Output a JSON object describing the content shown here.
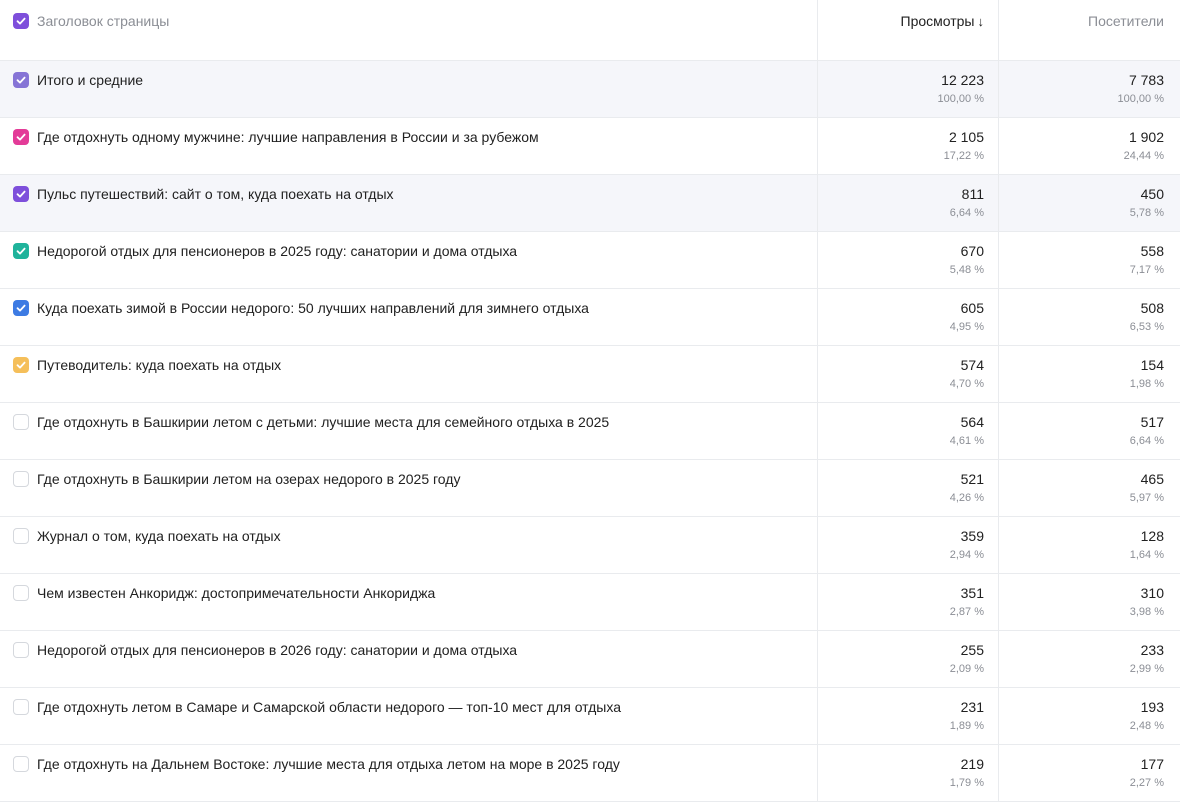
{
  "header": {
    "title_label": "Заголовок страницы",
    "views_label": "Просмотры",
    "sort_arrow": "↓",
    "visitors_label": "Посетители",
    "checkbox_color": "#7e4fdb"
  },
  "rows": [
    {
      "title": "Итого и средние",
      "views": "12 223",
      "views_pct": "100,00 %",
      "visitors": "7 783",
      "visitors_pct": "100,00 %",
      "color": "#8674d6",
      "checked": true,
      "shade": true
    },
    {
      "title": "Где отдохнуть одному мужчине: лучшие направления в России и за рубежом",
      "views": "2 105",
      "views_pct": "17,22 %",
      "visitors": "1 902",
      "visitors_pct": "24,44 %",
      "color": "#e33b98",
      "checked": true,
      "shade": false
    },
    {
      "title": "Пульс путешествий: сайт о том, куда поехать на отдых",
      "views": "811",
      "views_pct": "6,64 %",
      "visitors": "450",
      "visitors_pct": "5,78 %",
      "color": "#7e4fdb",
      "checked": true,
      "shade": true
    },
    {
      "title": "Недорогой отдых для пенсионеров в 2025 году: санатории и дома отдыха",
      "views": "670",
      "views_pct": "5,48 %",
      "visitors": "558",
      "visitors_pct": "7,17 %",
      "color": "#1fb39b",
      "checked": true,
      "shade": false
    },
    {
      "title": "Куда поехать зимой в России недорого: 50 лучших направлений для зимнего отдыха",
      "views": "605",
      "views_pct": "4,95 %",
      "visitors": "508",
      "visitors_pct": "6,53 %",
      "color": "#3d7be3",
      "checked": true,
      "shade": false
    },
    {
      "title": "Путеводитель: куда поехать на отдых",
      "views": "574",
      "views_pct": "4,70 %",
      "visitors": "154",
      "visitors_pct": "1,98 %",
      "color": "#f5bf5a",
      "checked": true,
      "shade": false
    },
    {
      "title": "Где отдохнуть в Башкирии летом с детьми: лучшие места для семейного отдыха в 2025",
      "views": "564",
      "views_pct": "4,61 %",
      "visitors": "517",
      "visitors_pct": "6,64 %",
      "color": "",
      "checked": false,
      "shade": false
    },
    {
      "title": "Где отдохнуть в Башкирии летом на озерах недорого в 2025 году",
      "views": "521",
      "views_pct": "4,26 %",
      "visitors": "465",
      "visitors_pct": "5,97 %",
      "color": "",
      "checked": false,
      "shade": false
    },
    {
      "title": "Журнал о том, куда поехать на отдых",
      "views": "359",
      "views_pct": "2,94 %",
      "visitors": "128",
      "visitors_pct": "1,64 %",
      "color": "",
      "checked": false,
      "shade": false
    },
    {
      "title": "Чем известен Анкоридж: достопримечательности Анкориджа",
      "views": "351",
      "views_pct": "2,87 %",
      "visitors": "310",
      "visitors_pct": "3,98 %",
      "color": "",
      "checked": false,
      "shade": false
    },
    {
      "title": "Недорогой отдых для пенсионеров в 2026 году: санатории и дома отдыха",
      "views": "255",
      "views_pct": "2,09 %",
      "visitors": "233",
      "visitors_pct": "2,99 %",
      "color": "",
      "checked": false,
      "shade": false
    },
    {
      "title": "Где отдохнуть летом в Самаре и Самарской области недорого — топ-10 мест для отдыха",
      "views": "231",
      "views_pct": "1,89 %",
      "visitors": "193",
      "visitors_pct": "2,48 %",
      "color": "",
      "checked": false,
      "shade": false
    },
    {
      "title": "Где отдохнуть на Дальнем Востоке: лучшие места для отдыха летом на море в 2025 году",
      "views": "219",
      "views_pct": "1,79 %",
      "visitors": "177",
      "visitors_pct": "2,27 %",
      "color": "",
      "checked": false,
      "shade": false
    }
  ]
}
